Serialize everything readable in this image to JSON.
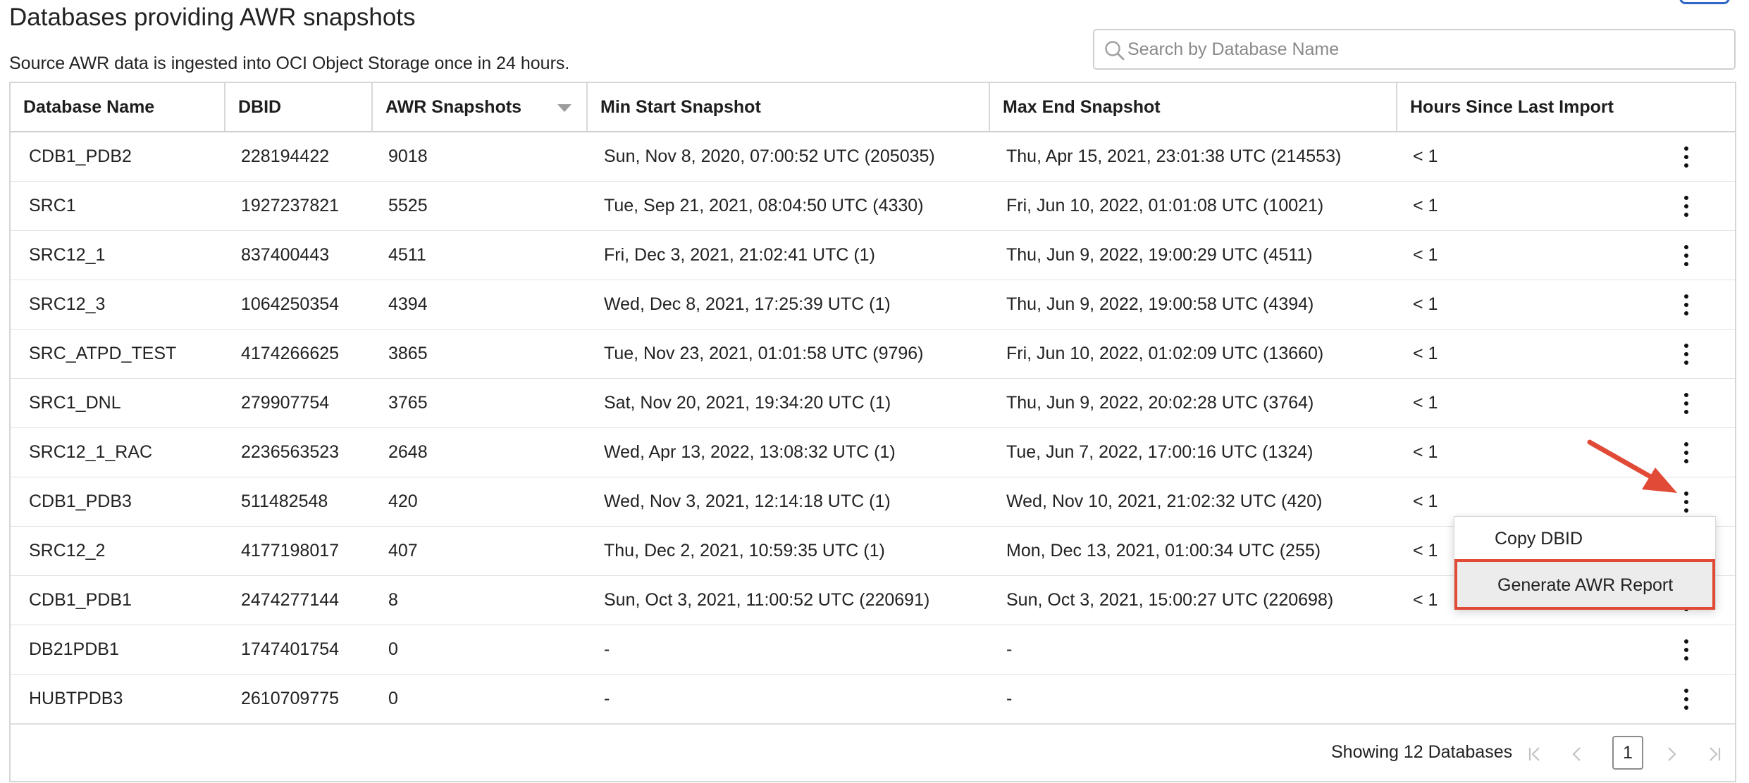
{
  "page": {
    "title": "Databases providing AWR snapshots",
    "subtitle": "Source AWR data is ingested into OCI Object Storage once in 24 hours.",
    "accent_color": "#2d66c4"
  },
  "search": {
    "placeholder": "Search by Database Name",
    "value": "",
    "icon": "search-icon"
  },
  "table": {
    "columns": [
      {
        "label": "Database Name",
        "sortable": false
      },
      {
        "label": "DBID",
        "sortable": false
      },
      {
        "label": "AWR Snapshots",
        "sortable": true,
        "sort": "descending"
      },
      {
        "label": "Min Start Snapshot",
        "sortable": false
      },
      {
        "label": "Max End Snapshot",
        "sortable": false
      },
      {
        "label": "Hours Since Last Import",
        "sortable": false
      }
    ],
    "rows": [
      {
        "name": "CDB1_PDB2",
        "dbid": "228194422",
        "snapshots": "9018",
        "min_start": "Sun, Nov 8, 2020, 07:00:52 UTC (205035)",
        "max_end": "Thu, Apr 15, 2021, 23:01:38 UTC (214553)",
        "hours": "< 1"
      },
      {
        "name": "SRC1",
        "dbid": "1927237821",
        "snapshots": "5525",
        "min_start": "Tue, Sep 21, 2021, 08:04:50 UTC (4330)",
        "max_end": "Fri, Jun 10, 2022, 01:01:08 UTC (10021)",
        "hours": "< 1"
      },
      {
        "name": "SRC12_1",
        "dbid": "837400443",
        "snapshots": "4511",
        "min_start": "Fri, Dec 3, 2021, 21:02:41 UTC (1)",
        "max_end": "Thu, Jun 9, 2022, 19:00:29 UTC (4511)",
        "hours": "< 1"
      },
      {
        "name": "SRC12_3",
        "dbid": "1064250354",
        "snapshots": "4394",
        "min_start": "Wed, Dec 8, 2021, 17:25:39 UTC (1)",
        "max_end": "Thu, Jun 9, 2022, 19:00:58 UTC (4394)",
        "hours": "< 1"
      },
      {
        "name": "SRC_ATPD_TEST",
        "dbid": "4174266625",
        "snapshots": "3865",
        "min_start": "Tue, Nov 23, 2021, 01:01:58 UTC (9796)",
        "max_end": "Fri, Jun 10, 2022, 01:02:09 UTC (13660)",
        "hours": "< 1"
      },
      {
        "name": "SRC1_DNL",
        "dbid": "279907754",
        "snapshots": "3765",
        "min_start": "Sat, Nov 20, 2021, 19:34:20 UTC (1)",
        "max_end": "Thu, Jun 9, 2022, 20:02:28 UTC (3764)",
        "hours": "< 1"
      },
      {
        "name": "SRC12_1_RAC",
        "dbid": "2236563523",
        "snapshots": "2648",
        "min_start": "Wed, Apr 13, 2022, 13:08:32 UTC (1)",
        "max_end": "Tue, Jun 7, 2022, 17:00:16 UTC (1324)",
        "hours": "< 1"
      },
      {
        "name": "CDB1_PDB3",
        "dbid": "511482548",
        "snapshots": "420",
        "min_start": "Wed, Nov 3, 2021, 12:14:18 UTC (1)",
        "max_end": "Wed, Nov 10, 2021, 21:02:32 UTC (420)",
        "hours": "< 1"
      },
      {
        "name": "SRC12_2",
        "dbid": "4177198017",
        "snapshots": "407",
        "min_start": "Thu, Dec 2, 2021, 10:59:35 UTC (1)",
        "max_end": "Mon, Dec 13, 2021, 01:00:34 UTC (255)",
        "hours": "< 1"
      },
      {
        "name": "CDB1_PDB1",
        "dbid": "2474277144",
        "snapshots": "8",
        "min_start": "Sun, Oct 3, 2021, 11:00:52 UTC (220691)",
        "max_end": "Sun, Oct 3, 2021, 15:00:27 UTC (220698)",
        "hours": "< 1"
      },
      {
        "name": "DB21PDB1",
        "dbid": "1747401754",
        "snapshots": "0",
        "min_start": "-",
        "max_end": "-",
        "hours": ""
      },
      {
        "name": "HUBTPDB3",
        "dbid": "2610709775",
        "snapshots": "0",
        "min_start": "-",
        "max_end": "-",
        "hours": ""
      }
    ],
    "row_action_icon": "kebab-menu-icon"
  },
  "context_menu": {
    "items": [
      {
        "label": "Copy DBID"
      },
      {
        "label": "Generate AWR Report",
        "highlighted": true
      }
    ],
    "highlight_color": "#e04a36"
  },
  "footer": {
    "showing": "Showing 12 Databases",
    "current_page": "1",
    "icons": [
      "first-page-icon",
      "previous-page-icon",
      "next-page-icon",
      "last-page-icon"
    ]
  },
  "annotation": {
    "arrow_color": "#e04a36",
    "icon": "red-arrow-icon"
  }
}
